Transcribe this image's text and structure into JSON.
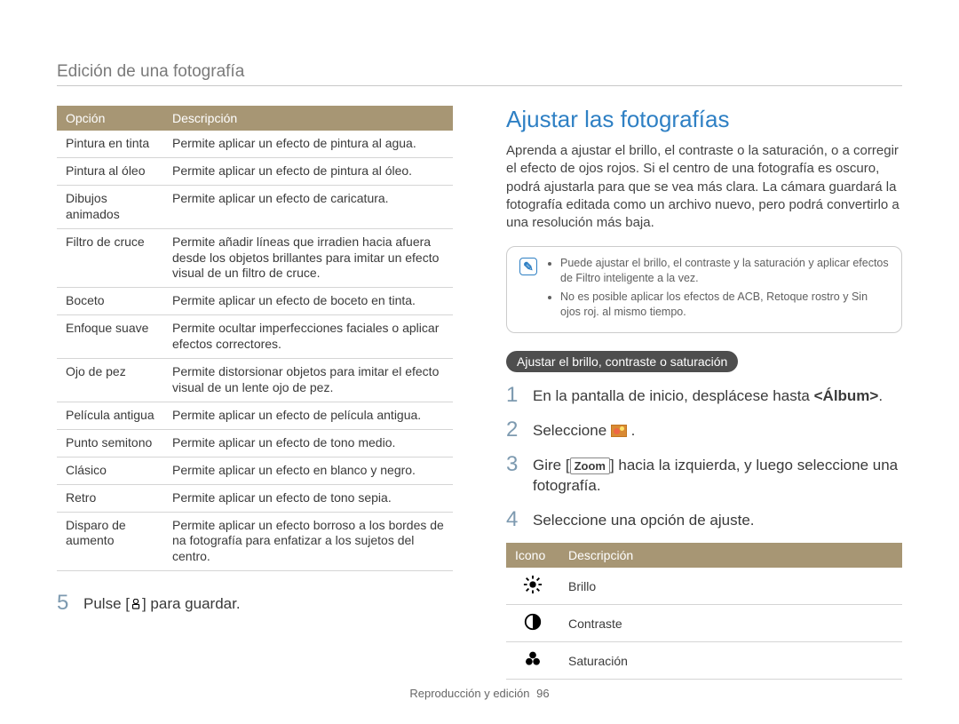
{
  "breadcrumb": "Edición de una fotografía",
  "left": {
    "headers": {
      "option": "Opción",
      "desc": "Descripción"
    },
    "rows": [
      {
        "k": "Pintura en tinta",
        "v": "Permite aplicar un efecto de pintura al agua."
      },
      {
        "k": "Pintura al óleo",
        "v": "Permite aplicar un efecto de pintura al óleo."
      },
      {
        "k": "Dibujos animados",
        "v": "Permite aplicar un efecto de caricatura."
      },
      {
        "k": "Filtro de cruce",
        "v": "Permite añadir líneas que irradien hacia afuera desde los objetos brillantes para imitar un efecto visual de un filtro de cruce."
      },
      {
        "k": "Boceto",
        "v": "Permite aplicar un efecto de boceto en tinta."
      },
      {
        "k": "Enfoque suave",
        "v": "Permite ocultar imperfecciones faciales o aplicar efectos correctores."
      },
      {
        "k": "Ojo de pez",
        "v": "Permite distorsionar objetos para imitar el efecto visual de un lente ojo de pez."
      },
      {
        "k": "Película antigua",
        "v": "Permite aplicar un efecto de película antigua."
      },
      {
        "k": "Punto semitono",
        "v": "Permite aplicar un efecto de tono medio."
      },
      {
        "k": "Clásico",
        "v": "Permite aplicar un efecto en blanco y negro."
      },
      {
        "k": "Retro",
        "v": "Permite aplicar un efecto de tono sepia."
      },
      {
        "k": "Disparo de aumento",
        "v": "Permite aplicar un efecto borroso a los bordes de na fotografía para enfatizar a los sujetos del centro."
      }
    ],
    "step5": {
      "num": "5",
      "pre": "Pulse [",
      "post": "] para guardar."
    }
  },
  "right": {
    "heading": "Ajustar las fotografías",
    "intro": "Aprenda a ajustar el brillo, el contraste o la saturación, o a corregir el efecto de ojos rojos. Si el centro de una fotografía es oscuro, podrá ajustarla para que se vea más clara. La cámara guardará la fotografía editada como un archivo nuevo, pero podrá convertirlo a una resolución más baja.",
    "notes": [
      "Puede ajustar el brillo, el contraste y la saturación y aplicar efectos de Filtro inteligente a la vez.",
      "No es posible aplicar los efectos de ACB, Retoque rostro y Sin ojos roj. al mismo tiempo."
    ],
    "pill": "Ajustar el brillo, contraste o saturación",
    "steps": {
      "1": {
        "num": "1",
        "pre": "En la pantalla de inicio, desplácese hasta ",
        "bold": "<Álbum>",
        "post": "."
      },
      "2": {
        "num": "2",
        "pre": "Seleccione ",
        "post": " ."
      },
      "3": {
        "num": "3",
        "pre": "Gire [",
        "key": "Zoom",
        "mid": "] hacia la izquierda, y luego seleccione una fotografía."
      },
      "4": {
        "num": "4",
        "text": "Seleccione una opción de ajuste."
      }
    },
    "iconTable": {
      "headers": {
        "icon": "Icono",
        "desc": "Descripción"
      },
      "rows": [
        {
          "icon": "brightness",
          "label": "Brillo"
        },
        {
          "icon": "contrast",
          "label": "Contraste"
        },
        {
          "icon": "saturation",
          "label": "Saturación"
        }
      ]
    }
  },
  "footer": {
    "text": "Reproducción y edición",
    "page": "96"
  }
}
